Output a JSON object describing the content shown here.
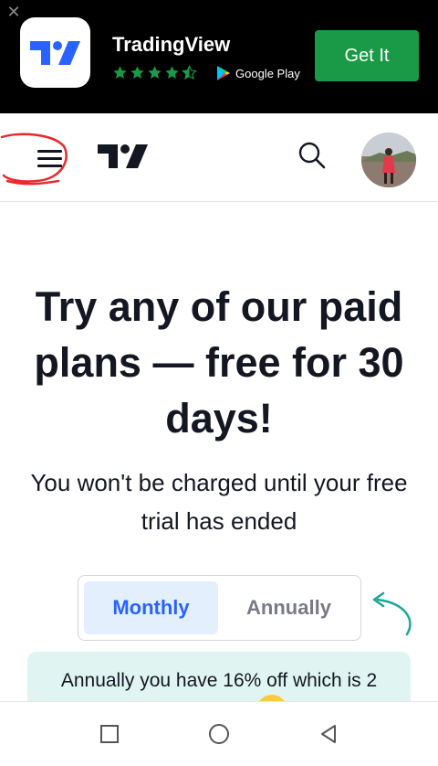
{
  "banner": {
    "close_icon": "close-icon",
    "app_name": "TradingView",
    "rating": 4.5,
    "store_label": "Google Play",
    "get_label": "Get It",
    "colors": {
      "background": "#000000",
      "button": "#1a9a47",
      "stars": "#1a9a47"
    }
  },
  "header": {
    "menu_icon": "hamburger-menu-icon",
    "logo_icon": "tradingview-logo-icon",
    "search_icon": "search-icon",
    "avatar_icon": "user-avatar"
  },
  "main": {
    "headline": "Try any of our paid plans — free for 30 days!",
    "subtext": "You won't be charged until your free trial has ended",
    "billing_toggle": {
      "options": [
        "Monthly",
        "Annually"
      ],
      "selected": "Monthly"
    },
    "promo_text": "Annually you have 16% off which is 2",
    "colors": {
      "accent": "#2962ff",
      "toggle_active_bg": "#e3effd",
      "promo_bg": "#e0f5f1",
      "arrow": "#1aa89a",
      "annotation": "#e8292b"
    }
  },
  "system_nav": {
    "recents_icon": "square-recents-icon",
    "home_icon": "circle-home-icon",
    "back_icon": "triangle-back-icon"
  }
}
